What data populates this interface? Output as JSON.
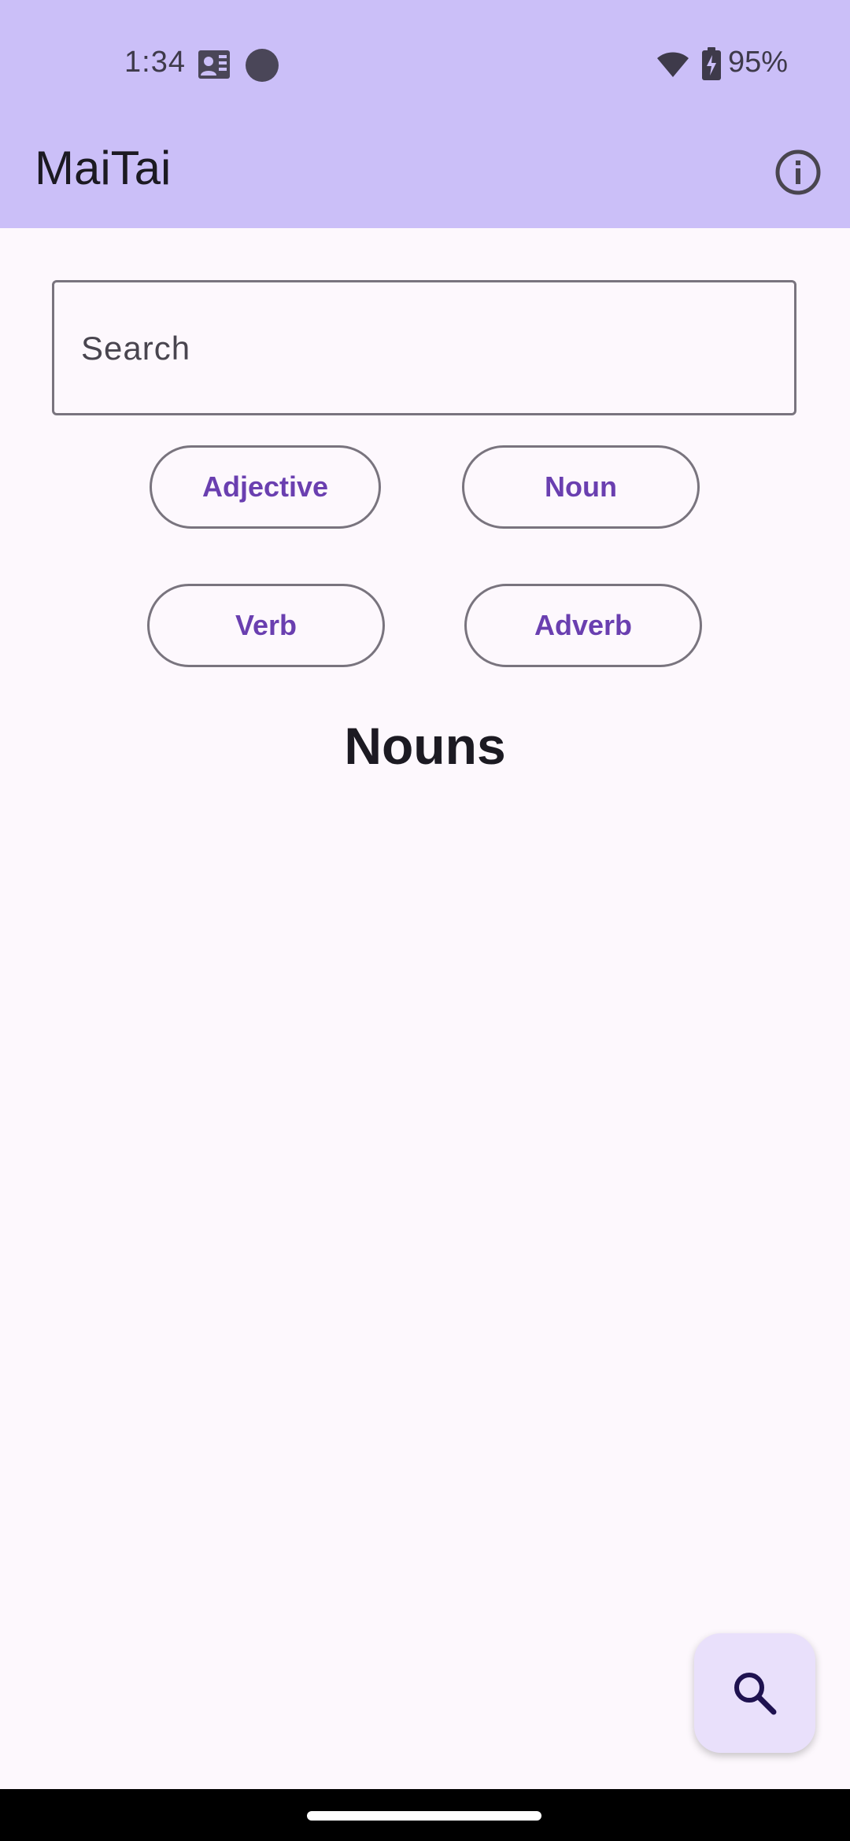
{
  "status_bar": {
    "time": "1:34",
    "battery": "95%",
    "icons": [
      "contacts-card-icon",
      "record-dot-icon",
      "wifi-icon",
      "battery-charging-icon"
    ]
  },
  "app_bar": {
    "title": "MaiTai",
    "info_icon": "info-icon"
  },
  "search": {
    "placeholder": "Search",
    "value": ""
  },
  "filters": {
    "chips": [
      {
        "label": "Adjective"
      },
      {
        "label": "Noun"
      },
      {
        "label": "Verb"
      },
      {
        "label": "Adverb"
      }
    ]
  },
  "main": {
    "section_title": "Nouns"
  },
  "fab": {
    "icon": "search-icon"
  },
  "colors": {
    "app_bar_bg": "#cbbff8",
    "background": "#fdf8fd",
    "chip_text": "#6a3fb0",
    "fab_bg": "#e9e0fb",
    "outline": "#79747e"
  }
}
